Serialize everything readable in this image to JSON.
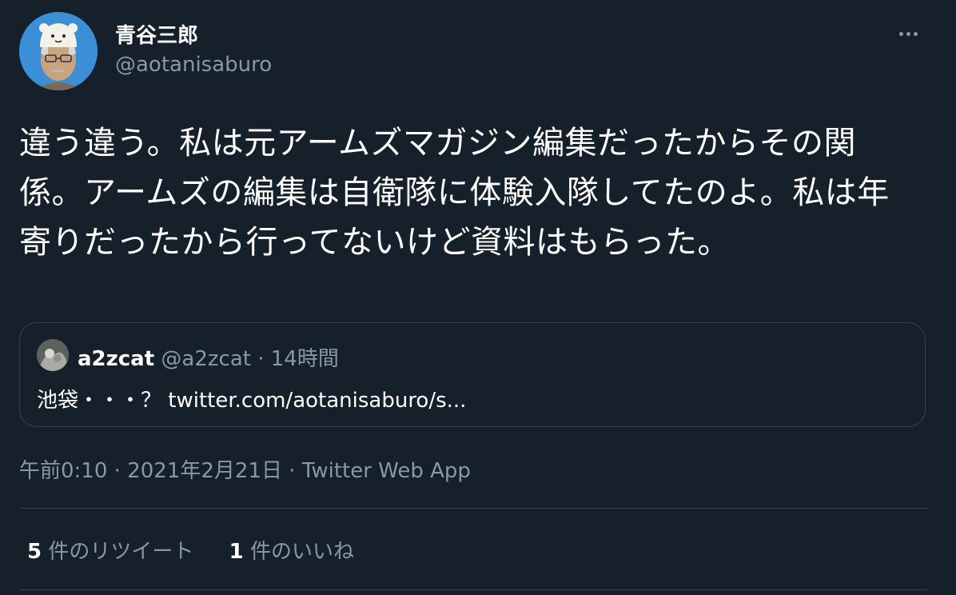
{
  "tweet": {
    "author": {
      "display_name": "青谷三郎",
      "handle": "@aotanisaburo"
    },
    "text": "違う違う。私は元アームズマガジン編集だったからその関係。アームズの編集は自衛隊に体験入隊してたのよ。私は年寄りだったから行ってないけど資料はもらった。",
    "more_icon": "more-horizontal-icon"
  },
  "quote": {
    "display_name": "a2zcat",
    "meta": "@a2zcat · 14時間",
    "text": "池袋・・・？ twitter.com/aotanisaburo/s..."
  },
  "meta": {
    "time": "午前0:10",
    "separator1": " · ",
    "date": "2021年2月21日",
    "separator2": " · ",
    "source": "Twitter Web App"
  },
  "stats": {
    "retweets": {
      "count": "5",
      "label": " 件のリツイート"
    },
    "likes": {
      "count": "1",
      "label": " 件のいいね"
    }
  },
  "colors": {
    "background": "#15202b",
    "text_primary": "#ffffff",
    "text_secondary": "#8899a6",
    "border": "#38444d"
  }
}
